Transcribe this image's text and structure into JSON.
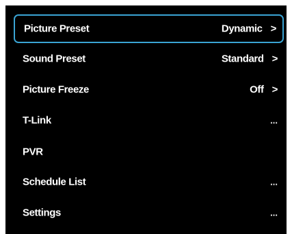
{
  "colors": {
    "panel_background": "#000000",
    "text": "#ffffff",
    "selection_border": "#3aa4d4"
  },
  "menu": {
    "items": [
      {
        "label": "Picture Preset",
        "value": "Dynamic",
        "icon": "chevron-right-icon",
        "selected": true
      },
      {
        "label": "Sound Preset",
        "value": "Standard",
        "icon": "chevron-right-icon",
        "selected": false
      },
      {
        "label": "Picture Freeze",
        "value": "Off",
        "icon": "chevron-right-icon",
        "selected": false
      },
      {
        "label": "T-Link",
        "value": "...",
        "icon": "ellipsis-icon",
        "selected": false
      },
      {
        "label": "PVR",
        "value": "",
        "icon": "",
        "selected": false
      },
      {
        "label": "Schedule List",
        "value": "...",
        "icon": "ellipsis-icon",
        "selected": false
      },
      {
        "label": "Settings",
        "value": "...",
        "icon": "ellipsis-icon",
        "selected": false
      }
    ],
    "chevron_glyph": ">"
  }
}
